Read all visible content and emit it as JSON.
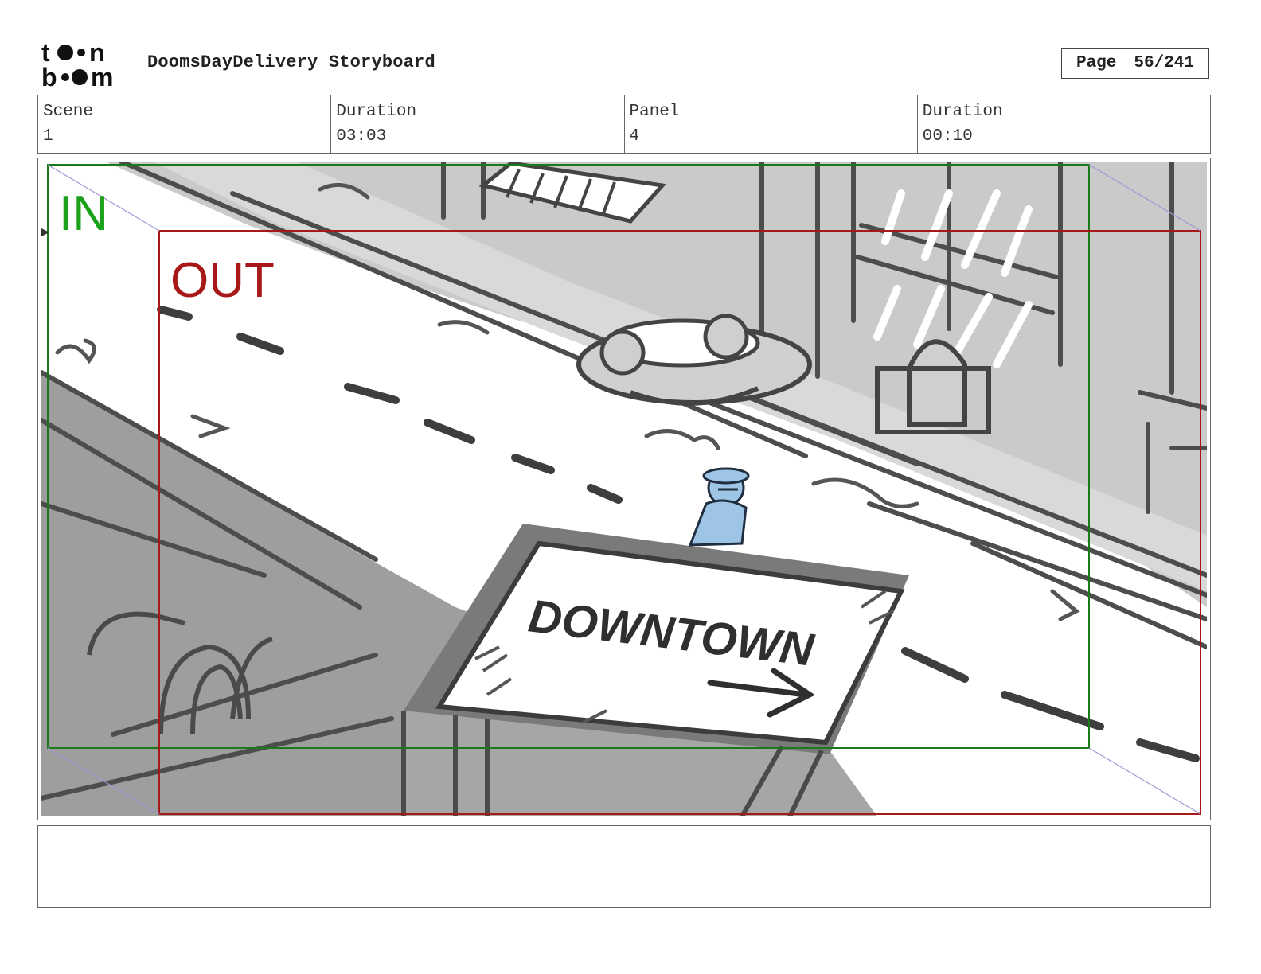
{
  "header": {
    "logo_text": "toonboom",
    "document_title": "DoomsDayDelivery Storyboard",
    "page_label": "Page",
    "page_value": "56/241"
  },
  "info": {
    "scene_label": "Scene",
    "scene_value": "1",
    "scene_duration_label": "Duration",
    "scene_duration_value": "03:03",
    "panel_label": "Panel",
    "panel_value": "4",
    "panel_duration_label": "Duration",
    "panel_duration_value": "00:10"
  },
  "panel": {
    "in_label": "IN",
    "out_label": "OUT",
    "sign_text": "DOWNTOWN",
    "in_color": "#1a8a1a",
    "out_color": "#a81818",
    "sketch_color": "#555555",
    "character_color": "#9ec4e6"
  },
  "caption": {
    "text": ""
  }
}
